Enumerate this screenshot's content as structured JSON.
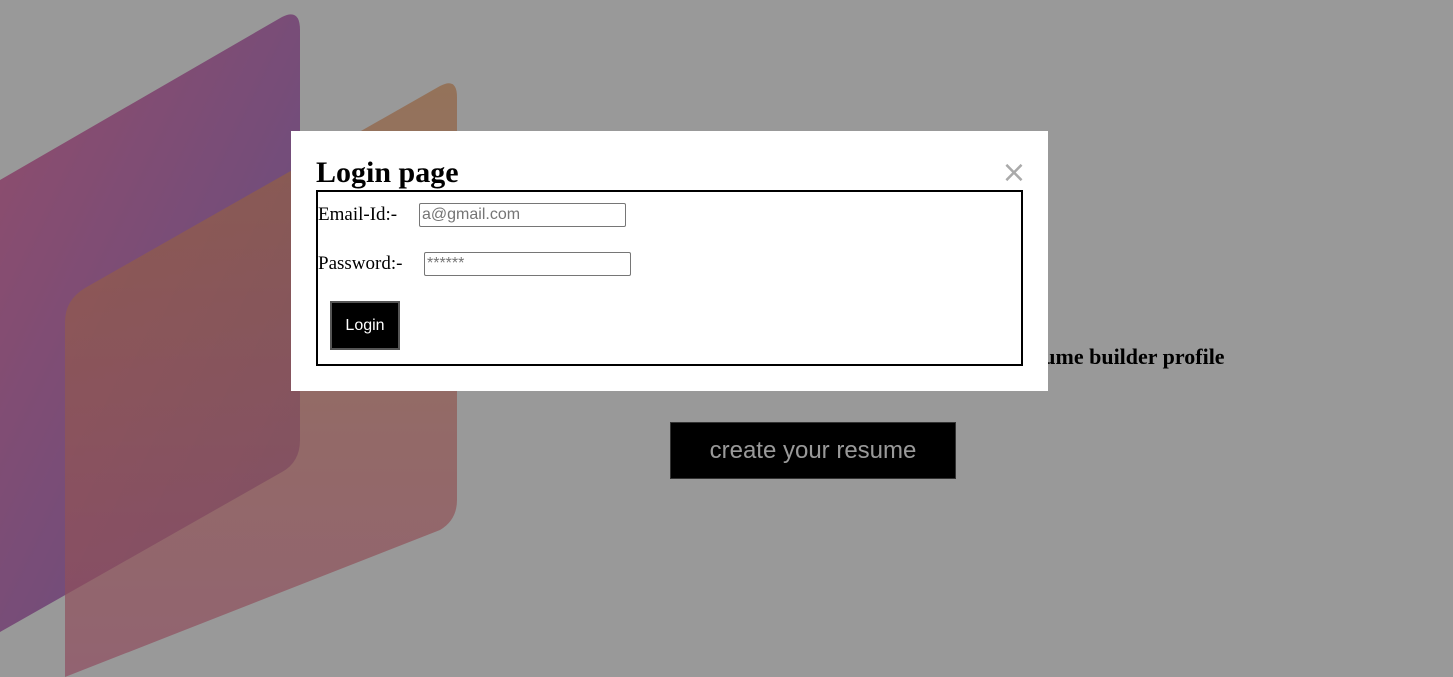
{
  "hero": {
    "text": "Land any job using our best-in-class resume builder profile",
    "cta_label": "create your resume"
  },
  "modal": {
    "title": "Login page",
    "close_symbol": "×",
    "email_label": "Email-Id:-",
    "email_placeholder": "a@gmail.com",
    "email_value": "",
    "password_label": "Password:-",
    "password_placeholder": "******",
    "password_value": "",
    "login_label": "Login"
  },
  "colors": {
    "overlay": "#000000",
    "shape_purple": "#c76bd0",
    "shape_orange": "#f2a064",
    "button_bg": "#000000",
    "button_text": "#ffffff",
    "close_icon": "#aaaaaa"
  },
  "icons": {
    "close": "close-icon"
  }
}
